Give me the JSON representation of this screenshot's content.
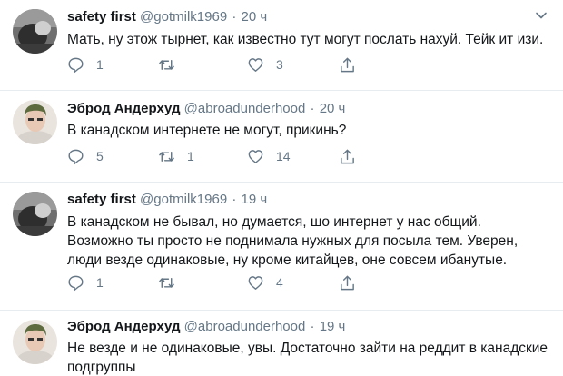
{
  "tweets": [
    {
      "name": "safety first",
      "handle": "@gotmilk1969",
      "separator": "·",
      "time": "20 ч",
      "text": "Мать, ну этож тырнет, как известно тут могут послать нахуй. Тейк ит изи.",
      "replies": "1",
      "retweets": "",
      "likes": "3"
    },
    {
      "name": "Эброд Андерхуд",
      "handle": "@abroadunderhood",
      "separator": "·",
      "time": "20 ч",
      "text": "В канадском интернете не могут, прикинь?",
      "replies": "5",
      "retweets": "1",
      "likes": "14"
    },
    {
      "name": "safety first",
      "handle": "@gotmilk1969",
      "separator": "·",
      "time": "19 ч",
      "text": "В канадском не бывал, но думается, шо интернет у нас общий. Возможно ты просто не поднимала нужных для посыла тем. Уверен, люди везде одинаковые, ну кроме китайцев, оне совсем ибанутые.",
      "replies": "1",
      "retweets": "",
      "likes": "4"
    },
    {
      "name": "Эброд Андерхуд",
      "handle": "@abroadunderhood",
      "separator": "·",
      "time": "19 ч",
      "text": "Не везде и не одинаковые, увы. Достаточно зайти на реддит в канадские подгруппы"
    }
  ],
  "icons": {
    "reply": "reply-icon",
    "retweet": "retweet-icon",
    "like": "heart-icon",
    "share": "share-icon",
    "more": "chevron-down-icon"
  },
  "colors": {
    "text": "#14171a",
    "secondary": "#657786",
    "divider": "#e6ecf0"
  }
}
